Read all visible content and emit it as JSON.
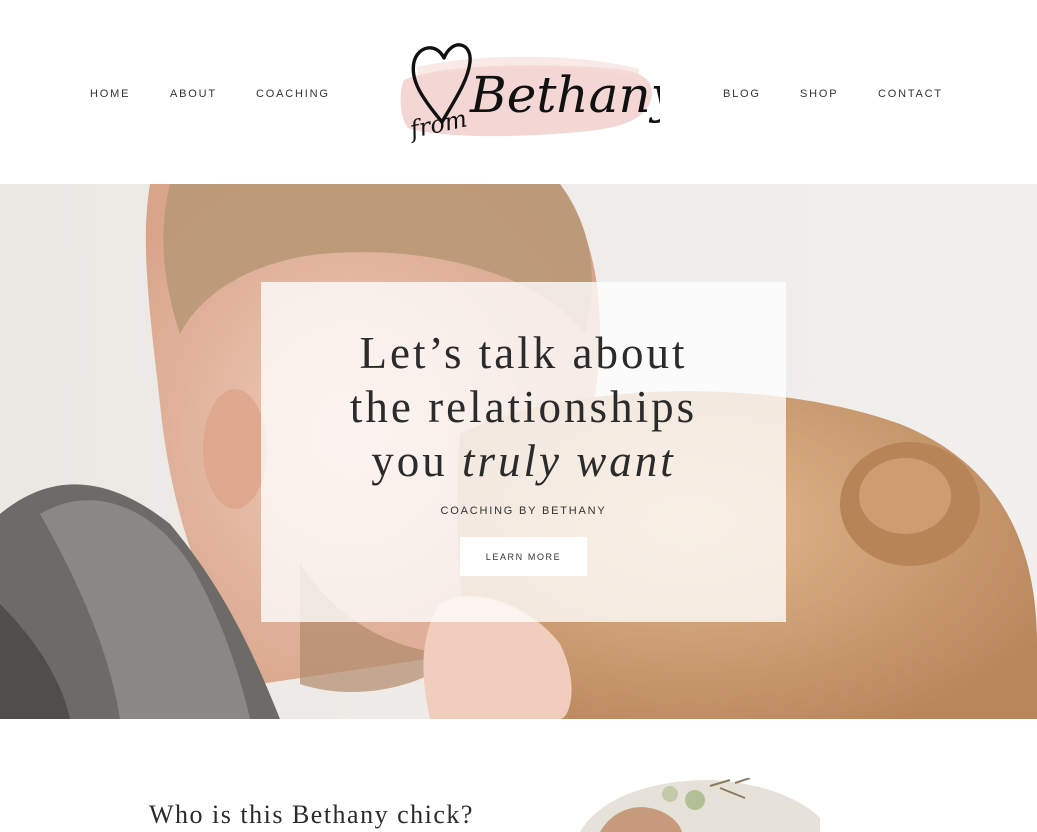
{
  "nav": {
    "left": [
      "HOME",
      "ABOUT",
      "COACHING"
    ],
    "right": [
      "BLOG",
      "SHOP",
      "CONTACT"
    ]
  },
  "logo": {
    "from": "from",
    "name": "Bethany",
    "icon": "heart-icon",
    "brush_color": "#f2cfcc"
  },
  "hero": {
    "title_line1": "Let’s talk about",
    "title_line2": "the relationships",
    "title_line3_plain": "you ",
    "title_line3_italic": "truly want",
    "subtitle": "COACHING BY BETHANY",
    "button_label": "LEARN MORE"
  },
  "about": {
    "heading": "Who is this Bethany chick?"
  },
  "colors": {
    "text": "#2b2b2b",
    "card_bg": "rgba(255,255,255,0.78)",
    "logo_brush": "#f2cfcc"
  }
}
